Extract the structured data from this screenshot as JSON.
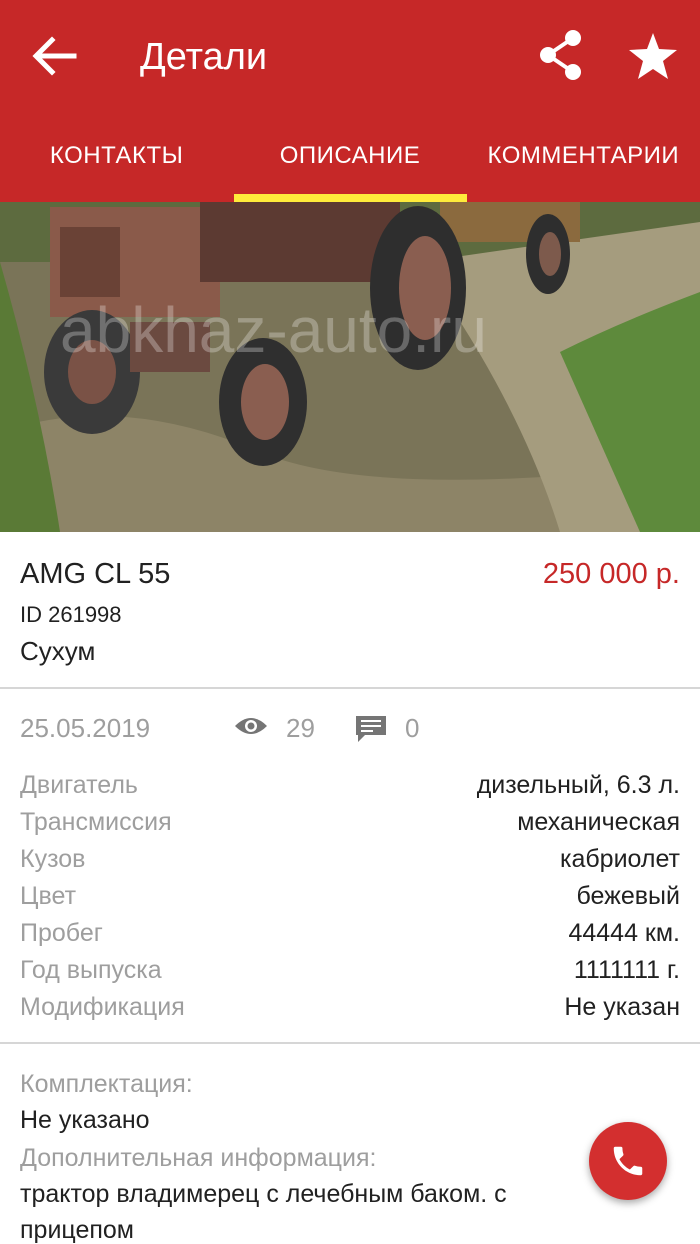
{
  "header": {
    "title": "Детали",
    "back_icon": "arrow-back-icon",
    "share_icon": "share-icon",
    "favorite_icon": "star-icon",
    "color": "#c62828"
  },
  "tabs": [
    {
      "label": "КОНТАКТЫ",
      "active": false
    },
    {
      "label": "ОПИСАНИЕ",
      "active": true
    },
    {
      "label": "КОММЕНТАРИИ",
      "active": false
    }
  ],
  "tab_indicator_color": "#ffeb3b",
  "gallery": {
    "image_count": 6,
    "active_index": 0,
    "watermark": "abkhaz-auto.ru"
  },
  "listing": {
    "model": "AMG CL 55",
    "price": "250 000 р.",
    "id": "ID 261998",
    "city": "Сухум",
    "price_color": "#c62828"
  },
  "meta": {
    "date": "25.05.2019",
    "views": "29",
    "comments": "0",
    "views_icon": "eye-icon",
    "comments_icon": "comment-icon"
  },
  "specs": [
    {
      "label": "Двигатель",
      "value": "дизельный, 6.3 л."
    },
    {
      "label": "Трансмиссия",
      "value": "механическая"
    },
    {
      "label": "Кузов",
      "value": "кабриолет"
    },
    {
      "label": "Цвет",
      "value": "бежевый"
    },
    {
      "label": "Пробег",
      "value": "44444 км."
    },
    {
      "label": "Год выпуска",
      "value": "1111111 г."
    },
    {
      "label": "Модификация",
      "value": "Не указан"
    }
  ],
  "extra": {
    "equipment_label": "Комплектация:",
    "equipment_value": "Не указано",
    "info_label": "Дополнительная информация:",
    "info_value": "трактор владимерец с лечебным баком. с прицепом"
  },
  "fab": {
    "icon": "phone-icon",
    "color": "#d32f2f"
  }
}
